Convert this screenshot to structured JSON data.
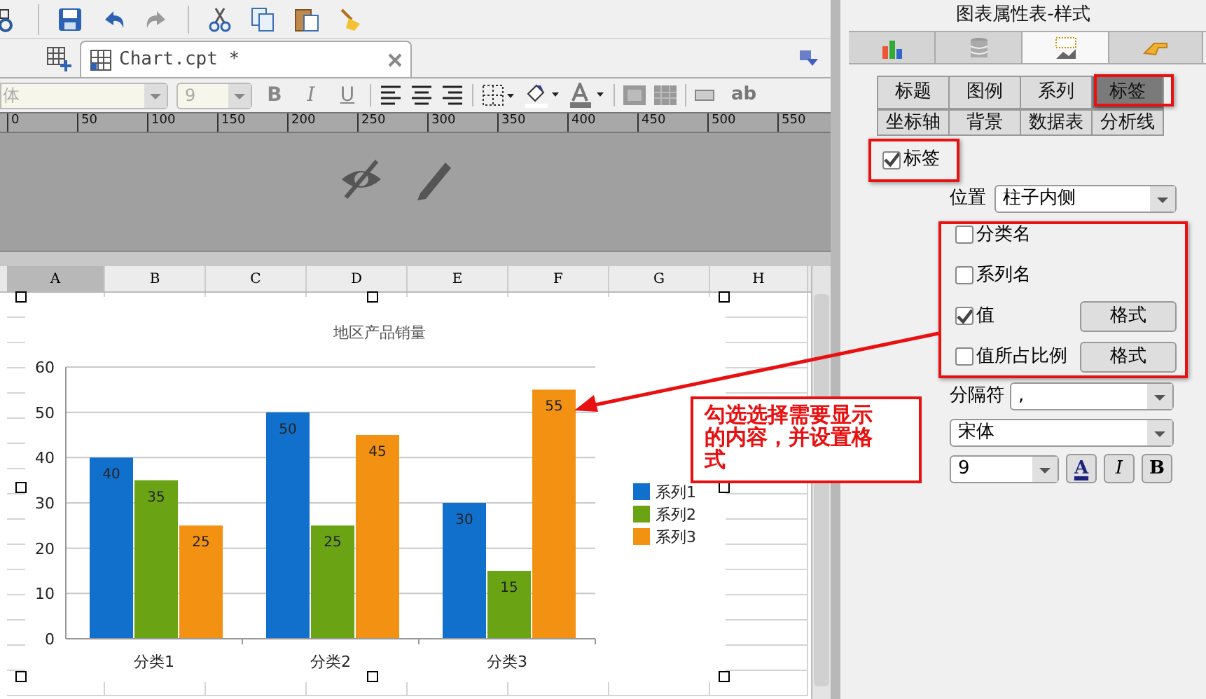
{
  "document_tab": {
    "label": "Chart.cpt *",
    "selected": true
  },
  "format_bar": {
    "font": "体",
    "size": "9",
    "style_buttons": [
      "B",
      "I",
      "U"
    ],
    "text_button": "ab"
  },
  "ruler": [
    "0",
    "50",
    "100",
    "150",
    "200",
    "250",
    "300",
    "350",
    "400",
    "450",
    "500",
    "550"
  ],
  "sheet": {
    "columns": [
      {
        "label": "A",
        "selected": true
      },
      {
        "label": "B",
        "selected": false
      },
      {
        "label": "C",
        "selected": false
      },
      {
        "label": "D",
        "selected": false
      },
      {
        "label": "E",
        "selected": false
      },
      {
        "label": "F",
        "selected": false
      },
      {
        "label": "G",
        "selected": false
      },
      {
        "label": "H",
        "selected": false
      }
    ]
  },
  "chart": {
    "chart_data": {
      "type": "bar",
      "title": "地区产品销量",
      "categories": [
        "分类1",
        "分类2",
        "分类3"
      ],
      "series": [
        {
          "name": "系列1",
          "color": "#1170cc",
          "values": [
            40,
            50,
            30
          ]
        },
        {
          "name": "系列2",
          "color": "#6aa313",
          "values": [
            35,
            25,
            15
          ]
        },
        {
          "name": "系列3",
          "color": "#f39212",
          "values": [
            25,
            45,
            55
          ]
        }
      ],
      "ylim": [
        0,
        60
      ],
      "yticks": [
        0,
        10,
        20,
        30,
        40,
        50,
        60
      ],
      "data_labels": true,
      "grid": true,
      "legend": true
    }
  },
  "annotation": {
    "text": "勾选选择需要显示的内容，并设置格式"
  },
  "panel": {
    "title": "图表属性表-样式",
    "icon_tabs": [
      {
        "selected": false
      },
      {
        "selected": false
      },
      {
        "selected": true
      },
      {
        "selected": false
      }
    ],
    "tabs_row_1": [
      {
        "label": "标题",
        "selected": false
      },
      {
        "label": "图例",
        "selected": false
      },
      {
        "label": "系列",
        "selected": false
      },
      {
        "label": "标签",
        "selected": true
      }
    ],
    "tabs_row_2": [
      {
        "label": "坐标轴",
        "selected": false
      },
      {
        "label": "背景",
        "selected": false
      },
      {
        "label": "数据表",
        "selected": false
      },
      {
        "label": "分析线",
        "selected": false
      }
    ],
    "show_labels": {
      "label": "标签",
      "checked": true
    },
    "position": {
      "label": "位置",
      "value": "柱子内侧"
    },
    "options": [
      {
        "label": "分类名",
        "checked": false
      },
      {
        "label": "系列名",
        "checked": false
      },
      {
        "label": "值",
        "checked": true,
        "button": "格式"
      },
      {
        "label": "值所占比例",
        "checked": false,
        "button": "格式"
      }
    ],
    "separator": {
      "label": "分隔符",
      "value": ","
    },
    "font": {
      "value": "宋体"
    },
    "size": {
      "value": "9"
    },
    "style_buttons": [
      "A",
      "I",
      "B"
    ]
  }
}
